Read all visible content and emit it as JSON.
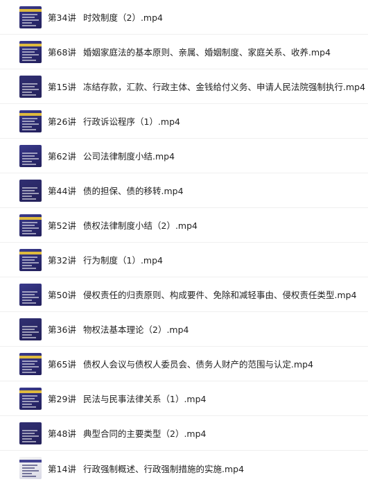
{
  "files": [
    {
      "num": "第34讲",
      "title": "时效制度（2）.mp4"
    },
    {
      "num": "第68讲",
      "title": "婚姻家庭法的基本原则、亲属、婚姻制度、家庭关系、收养.mp4"
    },
    {
      "num": "第15讲",
      "title": "冻结存款，汇款、行政主体、金钱给付义务、申请人民法院强制执行.mp4"
    },
    {
      "num": "第26讲",
      "title": "行政诉讼程序（1）.mp4"
    },
    {
      "num": "第62讲",
      "title": "公司法律制度小结.mp4"
    },
    {
      "num": "第44讲",
      "title": "债的担保、债的移转.mp4"
    },
    {
      "num": "第52讲",
      "title": "债权法律制度小结（2）.mp4"
    },
    {
      "num": "第32讲",
      "title": "行为制度（1）.mp4"
    },
    {
      "num": "第50讲",
      "title": "侵权责任的归责原则、构成要件、免除和减轻事由、侵权责任类型.mp4"
    },
    {
      "num": "第36讲",
      "title": "物权法基本理论（2）.mp4"
    },
    {
      "num": "第65讲",
      "title": "债权人会议与债权人委员会、债务人财产的范围与认定.mp4"
    },
    {
      "num": "第29讲",
      "title": "民法与民事法律关系（1）.mp4"
    },
    {
      "num": "第48讲",
      "title": "典型合同的主要类型（2）.mp4"
    },
    {
      "num": "第14讲",
      "title": "行政强制概述、行政强制措施的实施.mp4"
    }
  ],
  "thumbnail_icon": "video-thumbnail-icon",
  "colors": {
    "thumb_bg": "#2b2a70",
    "thumb_band": "#e8c23a",
    "text": "#222222",
    "divider": "#efefef"
  }
}
